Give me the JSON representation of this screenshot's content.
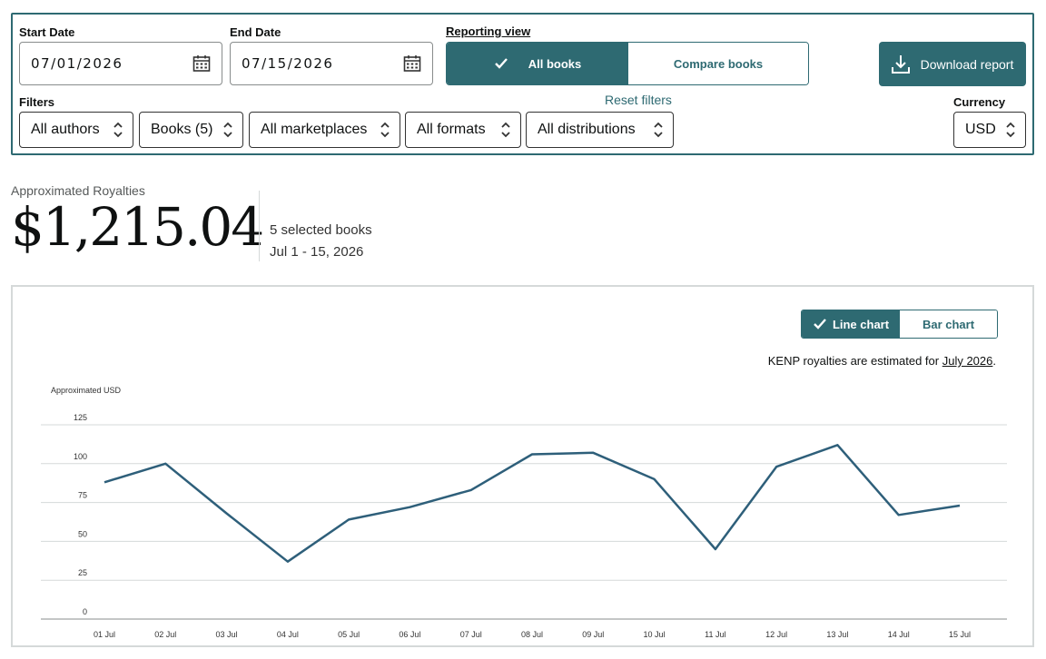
{
  "filters": {
    "start_date_label": "Start Date",
    "start_date_value": "07/01/2026",
    "end_date_label": "End Date",
    "end_date_value": "07/15/2026",
    "reporting_view_label": "Reporting view",
    "reporting_view_options": [
      "All books",
      "Compare books"
    ],
    "reporting_view_selected": "All books",
    "download_label": "Download report",
    "filters_label": "Filters",
    "reset_label": "Reset filters",
    "currency_label": "Currency",
    "selects": [
      {
        "name": "authors-select",
        "value": "All authors"
      },
      {
        "name": "books-select",
        "value": "Books (5)"
      },
      {
        "name": "marketplaces-select",
        "value": "All marketplaces"
      },
      {
        "name": "formats-select",
        "value": "All formats"
      },
      {
        "name": "distributions-select",
        "value": "All distributions"
      }
    ],
    "currency_value": "USD"
  },
  "summary": {
    "label": "Approximated Royalties",
    "amount": "$1,215.04",
    "selected": "5 selected books",
    "range": "Jul 1 - 15, 2026"
  },
  "chart_view": {
    "line_label": "Line chart",
    "bar_label": "Bar chart",
    "selected": "Line chart",
    "note_prefix": "KENP royalties are estimated for ",
    "note_link": "July 2026",
    "note_suffix": "."
  },
  "colors": {
    "accent": "#2e6a72",
    "line": "#2e5f7a",
    "grid": "#d5d9d9"
  },
  "chart_data": {
    "type": "line",
    "ylabel": "Approximated USD",
    "xlabel": "",
    "categories": [
      "01 Jul",
      "02 Jul",
      "03 Jul",
      "04 Jul",
      "05 Jul",
      "06 Jul",
      "07 Jul",
      "08 Jul",
      "09 Jul",
      "10 Jul",
      "11 Jul",
      "12 Jul",
      "13 Jul",
      "14 Jul",
      "15 Jul"
    ],
    "yticks": [
      0,
      25,
      50,
      75,
      100,
      125
    ],
    "ylim": [
      0,
      125
    ],
    "grid": true,
    "series": [
      {
        "values": [
          88,
          100,
          68,
          37,
          64,
          72,
          83,
          106,
          107,
          90,
          45,
          98,
          112,
          67,
          73
        ]
      }
    ]
  }
}
